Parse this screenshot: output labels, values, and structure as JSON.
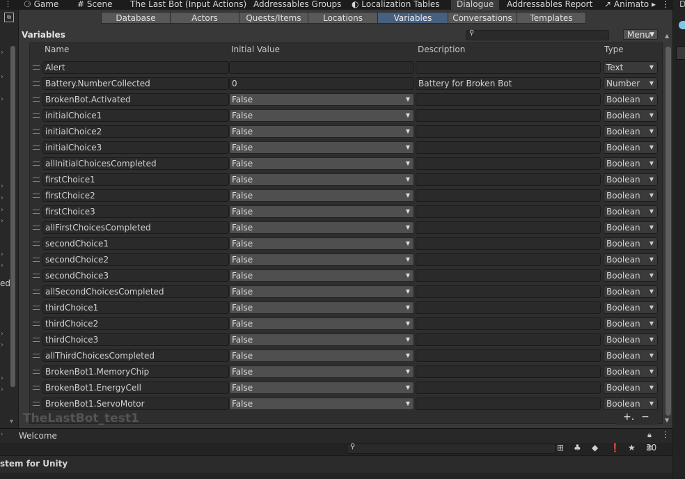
{
  "top_tabs": [
    "Game",
    "Scene",
    "The Last Bot (Input Actions)",
    "Addressables Groups",
    "Localization Tables",
    "Dialogue",
    "Addressables Report",
    "Animato"
  ],
  "right_strip_label": "D",
  "left_fragment": "ed",
  "sub_tabs": [
    "Database",
    "Actors",
    "Quests/Items",
    "Locations",
    "Variables",
    "Conversations",
    "Templates"
  ],
  "active_sub_tab": "Variables",
  "section_title": "Variables",
  "menu_label": "Menu",
  "columns": [
    "Name",
    "Initial Value",
    "Description",
    "Type"
  ],
  "variables": [
    {
      "name": "Alert",
      "initial": "",
      "description": "",
      "type": "Text"
    },
    {
      "name": "Battery.NumberCollected",
      "initial": "0",
      "description": "Battery for Broken Bot",
      "type": "Number"
    },
    {
      "name": "BrokenBot.Activated",
      "initial": "False",
      "description": "",
      "type": "Boolean"
    },
    {
      "name": "initialChoice1",
      "initial": "False",
      "description": "",
      "type": "Boolean"
    },
    {
      "name": "initialChoice2",
      "initial": "False",
      "description": "",
      "type": "Boolean"
    },
    {
      "name": "initialChoice3",
      "initial": "False",
      "description": "",
      "type": "Boolean"
    },
    {
      "name": "allInitialChoicesCompleted",
      "initial": "False",
      "description": "",
      "type": "Boolean"
    },
    {
      "name": "firstChoice1",
      "initial": "False",
      "description": "",
      "type": "Boolean"
    },
    {
      "name": "firstChoice2",
      "initial": "False",
      "description": "",
      "type": "Boolean"
    },
    {
      "name": "firstChoice3",
      "initial": "False",
      "description": "",
      "type": "Boolean"
    },
    {
      "name": "allFirstChoicesCompleted",
      "initial": "False",
      "description": "",
      "type": "Boolean"
    },
    {
      "name": "secondChoice1",
      "initial": "False",
      "description": "",
      "type": "Boolean"
    },
    {
      "name": "secondChoice2",
      "initial": "False",
      "description": "",
      "type": "Boolean"
    },
    {
      "name": "secondChoice3",
      "initial": "False",
      "description": "",
      "type": "Boolean"
    },
    {
      "name": "allSecondChoicesCompleted",
      "initial": "False",
      "description": "",
      "type": "Boolean"
    },
    {
      "name": "thirdChoice1",
      "initial": "False",
      "description": "",
      "type": "Boolean"
    },
    {
      "name": "thirdChoice2",
      "initial": "False",
      "description": "",
      "type": "Boolean"
    },
    {
      "name": "thirdChoice3",
      "initial": "False",
      "description": "",
      "type": "Boolean"
    },
    {
      "name": "allThirdChoicesCompleted",
      "initial": "False",
      "description": "",
      "type": "Boolean"
    },
    {
      "name": "BrokenBot1.MemoryChip",
      "initial": "False",
      "description": "",
      "type": "Boolean"
    },
    {
      "name": "BrokenBot1.EnergyCell",
      "initial": "False",
      "description": "",
      "type": "Boolean"
    },
    {
      "name": "BrokenBot1.ServoMotor",
      "initial": "False",
      "description": "",
      "type": "Boolean"
    }
  ],
  "watermark": "TheLastBot_test1",
  "console": {
    "label": "Welcome",
    "hidden_count": "30",
    "footer": "stem for Unity"
  },
  "icons": {
    "search": "search-icon",
    "dropdown": "chevron-down-icon",
    "add": "plus-icon",
    "remove": "minus-icon"
  },
  "colors": {
    "active_tab": "#48607f",
    "panel": "#383838",
    "field": "#2a2a2a"
  }
}
